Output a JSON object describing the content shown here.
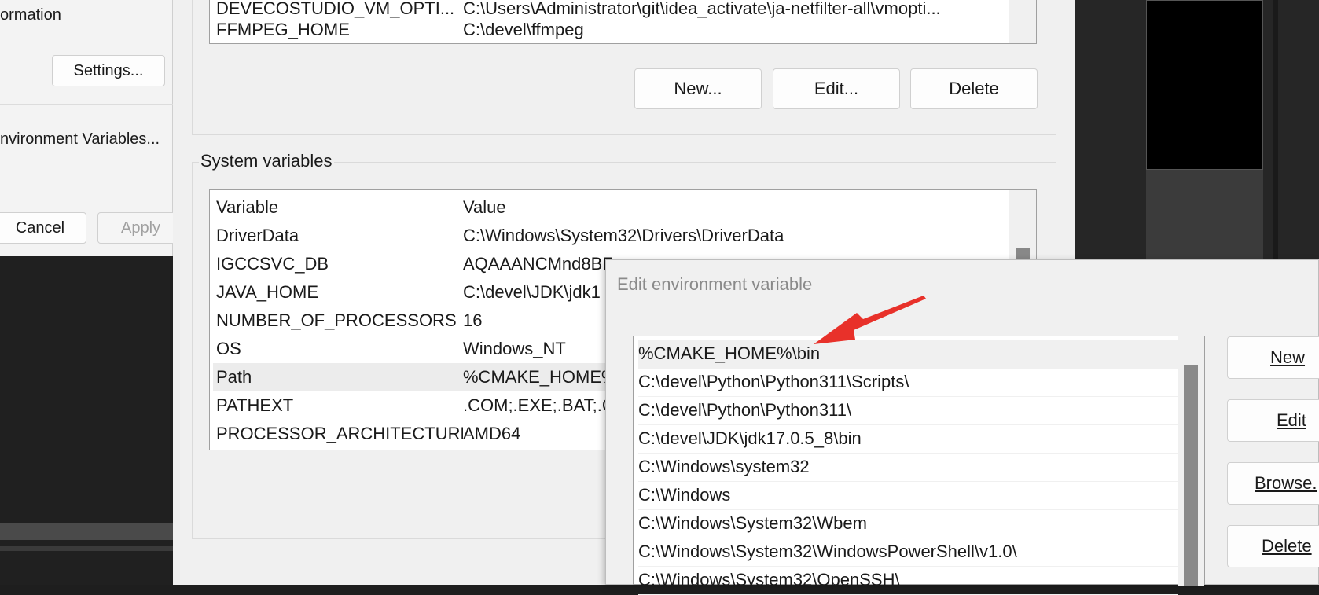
{
  "left_dialog": {
    "info_label": "ormation",
    "settings_button": "Settings...",
    "env_vars_button": "nvironment Variables...",
    "cancel_button": "Cancel",
    "apply_button": "Apply"
  },
  "user_vars": {
    "rows": [
      {
        "variable": "DEVECOSTUDIO_VM_OPTI...",
        "value": "C:\\Users\\Administrator\\git\\idea_activate\\ja-netfilter-all\\vmopti..."
      },
      {
        "variable": "FFMPEG_HOME",
        "value": "C:\\devel\\ffmpeg"
      }
    ],
    "new_button": "New...",
    "edit_button": "Edit...",
    "delete_button": "Delete"
  },
  "system_vars": {
    "legend": "System variables",
    "header": {
      "variable": "Variable",
      "value": "Value"
    },
    "rows": [
      {
        "variable": "DriverData",
        "value": "C:\\Windows\\System32\\Drivers\\DriverData"
      },
      {
        "variable": "IGCCSVC_DB",
        "value": "AQAAANCMnd8BF"
      },
      {
        "variable": "JAVA_HOME",
        "value": "C:\\devel\\JDK\\jdk1"
      },
      {
        "variable": "NUMBER_OF_PROCESSORS",
        "value": "16"
      },
      {
        "variable": "OS",
        "value": "Windows_NT"
      },
      {
        "variable": "Path",
        "value": "%CMAKE_HOME%"
      },
      {
        "variable": "PATHEXT",
        "value": ".COM;.EXE;.BAT;.C"
      },
      {
        "variable": "PROCESSOR_ARCHITECTURE",
        "value": "AMD64"
      }
    ]
  },
  "edit_dialog": {
    "title": "Edit environment variable",
    "entries": [
      "%CMAKE_HOME%\\bin",
      "C:\\devel\\Python\\Python311\\Scripts\\",
      "C:\\devel\\Python\\Python311\\",
      "C:\\devel\\JDK\\jdk17.0.5_8\\bin",
      "C:\\Windows\\system32",
      "C:\\Windows",
      "C:\\Windows\\System32\\Wbem",
      "C:\\Windows\\System32\\WindowsPowerShell\\v1.0\\",
      "C:\\Windows\\System32\\OpenSSH\\"
    ],
    "new_button": "New",
    "edit_button": "Edit",
    "browse_button": "Browse.",
    "delete_button": "Delete"
  },
  "colors": {
    "annotation_arrow": "#e8312a"
  }
}
